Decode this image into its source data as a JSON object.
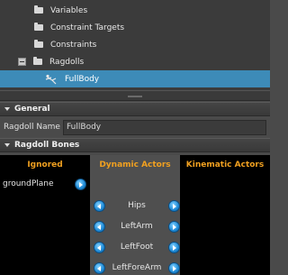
{
  "tree": {
    "items": [
      {
        "label": "Variables",
        "icon": "folder-icon"
      },
      {
        "label": "Constraint Targets",
        "icon": "folder-icon"
      },
      {
        "label": "Constraints",
        "icon": "folder-icon"
      },
      {
        "label": "Ragdolls",
        "icon": "folder-icon",
        "expanded": true
      },
      {
        "label": "FullBody",
        "icon": "ragdoll-icon",
        "selected": true
      }
    ]
  },
  "general": {
    "header": "General",
    "ragdoll_name_label": "Ragdoll Name",
    "ragdoll_name_value": "FullBody"
  },
  "ragdoll_bones": {
    "header": "Ragdoll Bones",
    "ignored_title": "Ignored",
    "dynamic_title": "Dynamic Actors",
    "kinematic_title": "Kinematic Actors",
    "ignored": [
      "groundPlane"
    ],
    "dynamic": [
      "Hips",
      "LeftArm",
      "LeftFoot",
      "LeftForeArm"
    ]
  },
  "colors": {
    "selection": "#3d8bb8",
    "column_title": "#f0a020",
    "button": "#1f8ad6"
  }
}
